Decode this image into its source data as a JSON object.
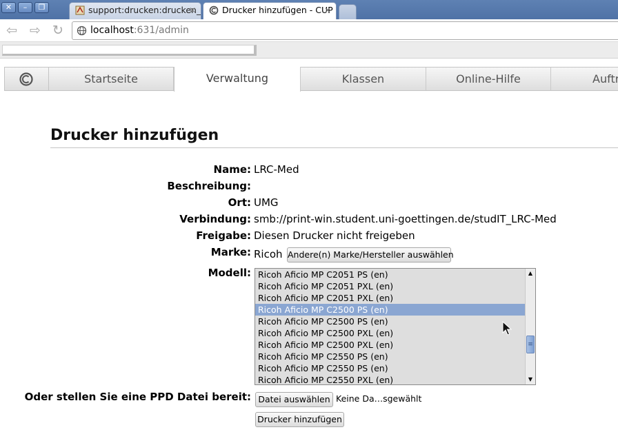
{
  "browser": {
    "tabs": [
      {
        "label": "support:drucken:drucken_",
        "active": false
      },
      {
        "label": "Drucker hinzufügen - CUP",
        "active": true
      }
    ],
    "address": {
      "host": "localhost",
      "rest": ":631/admin"
    }
  },
  "cups_nav": {
    "items": [
      "Startseite",
      "Verwaltung",
      "Klassen",
      "Online-Hilfe",
      "Aufträ"
    ],
    "current": "Verwaltung"
  },
  "page": {
    "title": "Drucker hinzufügen",
    "fields": {
      "name": {
        "label": "Name:",
        "value": "LRC-Med"
      },
      "description": {
        "label": "Beschreibung:",
        "value": ""
      },
      "location": {
        "label": "Ort:",
        "value": "UMG"
      },
      "connection": {
        "label": "Verbindung:",
        "value": "smb://print-win.student.uni-goettingen.de/studIT_LRC-Med"
      },
      "sharing": {
        "label": "Freigabe:",
        "value": "Diesen Drucker nicht freigeben"
      },
      "make": {
        "label": "Marke:",
        "value": "Ricoh",
        "button": "Andere(n) Marke/Hersteller auswählen"
      },
      "model": {
        "label": "Modell:",
        "options": [
          "Ricoh Aficio MP C2051 PS (en)",
          "Ricoh Aficio MP C2051 PXL (en)",
          "Ricoh Aficio MP C2051 PXL (en)",
          "Ricoh Aficio MP C2500 PS (en)",
          "Ricoh Aficio MP C2500 PS (en)",
          "Ricoh Aficio MP C2500 PXL (en)",
          "Ricoh Aficio MP C2500 PXL (en)",
          "Ricoh Aficio MP C2550 PS (en)",
          "Ricoh Aficio MP C2550 PS (en)",
          "Ricoh Aficio MP C2550 PXL (en)"
        ],
        "selected_index": 3
      },
      "ppd": {
        "label": "Oder stellen Sie eine PPD Datei bereit:",
        "button": "Datei auswählen",
        "file_status": "Keine Da…sgewählt"
      }
    },
    "submit_label": "Drucker hinzufügen"
  },
  "colors": {
    "selection": "#8aa6d2",
    "titlebar": "#5577aa"
  }
}
